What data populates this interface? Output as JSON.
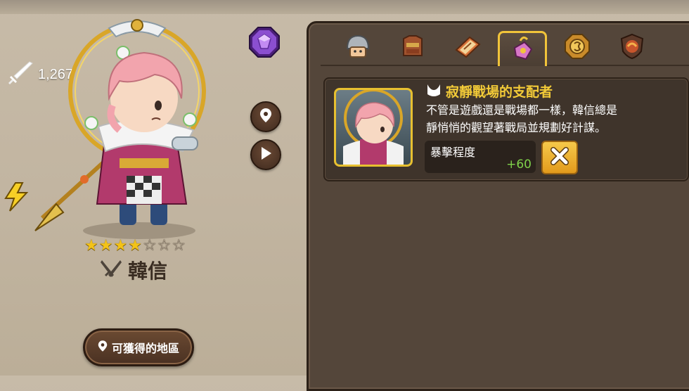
{
  "hero": {
    "name": "韓信",
    "power": "1,267",
    "stars_filled": 4,
    "stars_total": 7,
    "class_icon": "crossed-swords-icon",
    "find_location_label": "可獲得的地區"
  },
  "tabs": [
    {
      "icon": "helmet-icon",
      "active": false
    },
    {
      "icon": "armor-icon",
      "active": false
    },
    {
      "icon": "book-icon",
      "active": false
    },
    {
      "icon": "accessory-icon",
      "active": true
    },
    {
      "icon": "coin-icon",
      "active": false
    },
    {
      "icon": "shield-emblem-icon",
      "active": false
    }
  ],
  "item": {
    "type_icon": "costume-type-icon",
    "title": "寂靜戰場的支配者",
    "description_line1": "不管是遊戲還是戰場都一樣，韓信總是",
    "description_line2": "靜悄悄的觀望著戰局並規劃好計謀。",
    "stat_name": "暴擊程度",
    "stat_value": "+60"
  },
  "colors": {
    "accent_gold": "#f3cb38",
    "stat_green": "#7fd14a",
    "panel_bg": "#54463a"
  }
}
